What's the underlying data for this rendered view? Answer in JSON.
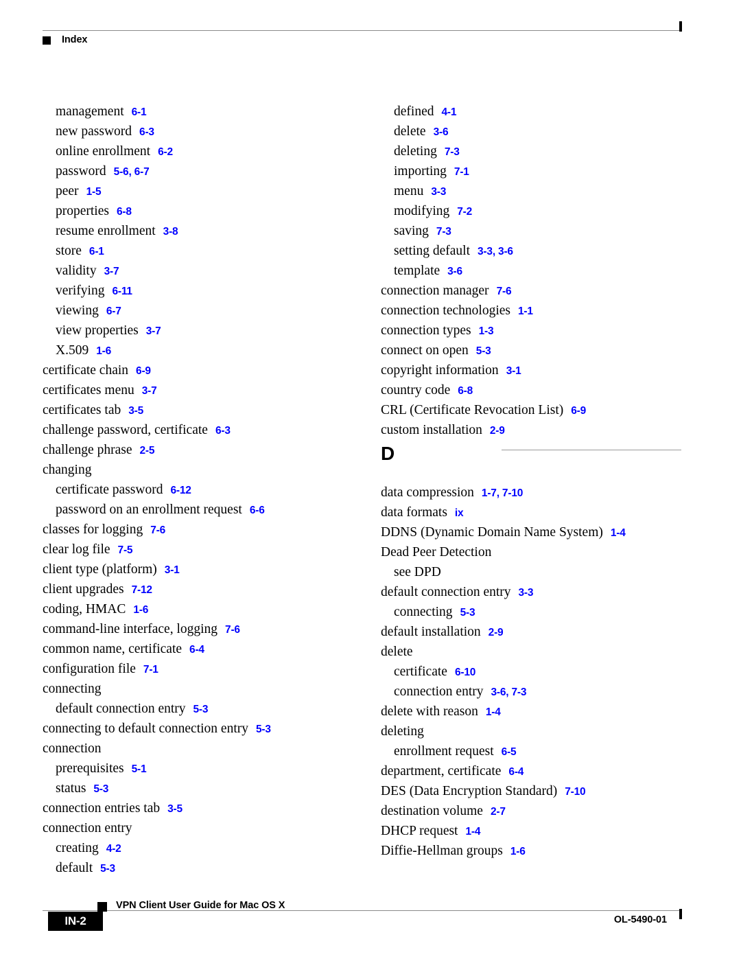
{
  "header": {
    "title": "Index",
    "bullet_icon": "black-square-icon"
  },
  "footer": {
    "page_number": "IN-2",
    "document_title": "VPN Client User Guide for Mac OS X",
    "document_id": "OL-5490-01",
    "bullet_icon": "black-square-icon"
  },
  "colors": {
    "reference_link": "#0000FF",
    "rule": "#8A8A8A",
    "text": "#000000"
  },
  "columns": {
    "left": [
      {
        "kind": "entry",
        "level": 1,
        "term": "management",
        "refs": "6-1"
      },
      {
        "kind": "entry",
        "level": 1,
        "term": "new password",
        "refs": "6-3"
      },
      {
        "kind": "entry",
        "level": 1,
        "term": "online enrollment",
        "refs": "6-2"
      },
      {
        "kind": "entry",
        "level": 1,
        "term": "password",
        "refs": "5-6, 6-7"
      },
      {
        "kind": "entry",
        "level": 1,
        "term": "peer",
        "refs": "1-5"
      },
      {
        "kind": "entry",
        "level": 1,
        "term": "properties",
        "refs": "6-8"
      },
      {
        "kind": "entry",
        "level": 1,
        "term": "resume enrollment",
        "refs": "3-8"
      },
      {
        "kind": "entry",
        "level": 1,
        "term": "store",
        "refs": "6-1"
      },
      {
        "kind": "entry",
        "level": 1,
        "term": "validity",
        "refs": "3-7"
      },
      {
        "kind": "entry",
        "level": 1,
        "term": "verifying",
        "refs": "6-11"
      },
      {
        "kind": "entry",
        "level": 1,
        "term": "viewing",
        "refs": "6-7"
      },
      {
        "kind": "entry",
        "level": 1,
        "term": "view properties",
        "refs": "3-7"
      },
      {
        "kind": "entry",
        "level": 1,
        "term": "X.509",
        "refs": "1-6"
      },
      {
        "kind": "entry",
        "level": 0,
        "term": "certificate chain",
        "refs": "6-9"
      },
      {
        "kind": "entry",
        "level": 0,
        "term": "certificates menu",
        "refs": "3-7"
      },
      {
        "kind": "entry",
        "level": 0,
        "term": "certificates tab",
        "refs": "3-5"
      },
      {
        "kind": "entry",
        "level": 0,
        "term": "challenge password, certificate",
        "refs": "6-3"
      },
      {
        "kind": "entry",
        "level": 0,
        "term": "challenge phrase",
        "refs": "2-5"
      },
      {
        "kind": "entry",
        "level": 0,
        "term": "changing",
        "refs": ""
      },
      {
        "kind": "entry",
        "level": 1,
        "term": "certificate password",
        "refs": "6-12"
      },
      {
        "kind": "entry",
        "level": 1,
        "term": "password on an enrollment request",
        "refs": "6-6"
      },
      {
        "kind": "entry",
        "level": 0,
        "term": "classes for logging",
        "refs": "7-6"
      },
      {
        "kind": "entry",
        "level": 0,
        "term": "clear log file",
        "refs": "7-5"
      },
      {
        "kind": "entry",
        "level": 0,
        "term": "client type (platform)",
        "refs": "3-1"
      },
      {
        "kind": "entry",
        "level": 0,
        "term": "client upgrades",
        "refs": "7-12"
      },
      {
        "kind": "entry",
        "level": 0,
        "term": "coding, HMAC",
        "refs": "1-6"
      },
      {
        "kind": "entry",
        "level": 0,
        "term": "command-line interface, logging",
        "refs": "7-6"
      },
      {
        "kind": "entry",
        "level": 0,
        "term": "common name, certificate",
        "refs": "6-4"
      },
      {
        "kind": "entry",
        "level": 0,
        "term": "configuration file",
        "refs": "7-1"
      },
      {
        "kind": "entry",
        "level": 0,
        "term": "connecting",
        "refs": ""
      },
      {
        "kind": "entry",
        "level": 1,
        "term": "default connection entry",
        "refs": "5-3"
      },
      {
        "kind": "entry",
        "level": 0,
        "term": "connecting to default connection entry",
        "refs": "5-3"
      },
      {
        "kind": "entry",
        "level": 0,
        "term": "connection",
        "refs": ""
      },
      {
        "kind": "entry",
        "level": 1,
        "term": "prerequisites",
        "refs": "5-1"
      },
      {
        "kind": "entry",
        "level": 1,
        "term": "status",
        "refs": "5-3"
      },
      {
        "kind": "entry",
        "level": 0,
        "term": "connection entries tab",
        "refs": "3-5"
      },
      {
        "kind": "entry",
        "level": 0,
        "term": "connection entry",
        "refs": ""
      },
      {
        "kind": "entry",
        "level": 1,
        "term": "creating",
        "refs": "4-2"
      },
      {
        "kind": "entry",
        "level": 1,
        "term": "default",
        "refs": "5-3"
      }
    ],
    "right": [
      {
        "kind": "entry",
        "level": 1,
        "term": "defined",
        "refs": "4-1"
      },
      {
        "kind": "entry",
        "level": 1,
        "term": "delete",
        "refs": "3-6"
      },
      {
        "kind": "entry",
        "level": 1,
        "term": "deleting",
        "refs": "7-3"
      },
      {
        "kind": "entry",
        "level": 1,
        "term": "importing",
        "refs": "7-1"
      },
      {
        "kind": "entry",
        "level": 1,
        "term": "menu",
        "refs": "3-3"
      },
      {
        "kind": "entry",
        "level": 1,
        "term": "modifying",
        "refs": "7-2"
      },
      {
        "kind": "entry",
        "level": 1,
        "term": "saving",
        "refs": "7-3"
      },
      {
        "kind": "entry",
        "level": 1,
        "term": "setting default",
        "refs": "3-3, 3-6"
      },
      {
        "kind": "entry",
        "level": 1,
        "term": "template",
        "refs": "3-6"
      },
      {
        "kind": "entry",
        "level": 0,
        "term": "connection manager",
        "refs": "7-6"
      },
      {
        "kind": "entry",
        "level": 0,
        "term": "connection technologies",
        "refs": "1-1"
      },
      {
        "kind": "entry",
        "level": 0,
        "term": "connection types",
        "refs": "1-3"
      },
      {
        "kind": "entry",
        "level": 0,
        "term": "connect on open",
        "refs": "5-3"
      },
      {
        "kind": "entry",
        "level": 0,
        "term": "copyright information",
        "refs": "3-1"
      },
      {
        "kind": "entry",
        "level": 0,
        "term": "country code",
        "refs": "6-8"
      },
      {
        "kind": "entry",
        "level": 0,
        "term": "CRL (Certificate Revocation List)",
        "refs": "6-9"
      },
      {
        "kind": "entry",
        "level": 0,
        "term": "custom installation",
        "refs": "2-9"
      },
      {
        "kind": "alpha",
        "letter": "D"
      },
      {
        "kind": "entry",
        "level": 0,
        "term": "data compression",
        "refs": "1-7, 7-10"
      },
      {
        "kind": "entry",
        "level": 0,
        "term": "data formats",
        "refs": "ix"
      },
      {
        "kind": "entry",
        "level": 0,
        "term": "DDNS (Dynamic Domain Name System)",
        "refs": "1-4"
      },
      {
        "kind": "entry",
        "level": 0,
        "term": "Dead Peer Detection",
        "refs": ""
      },
      {
        "kind": "entry",
        "level": 1,
        "term": "see DPD",
        "refs": ""
      },
      {
        "kind": "entry",
        "level": 0,
        "term": "default connection entry",
        "refs": "3-3"
      },
      {
        "kind": "entry",
        "level": 1,
        "term": "connecting",
        "refs": "5-3"
      },
      {
        "kind": "entry",
        "level": 0,
        "term": "default installation",
        "refs": "2-9"
      },
      {
        "kind": "entry",
        "level": 0,
        "term": "delete",
        "refs": ""
      },
      {
        "kind": "entry",
        "level": 1,
        "term": "certificate",
        "refs": "6-10"
      },
      {
        "kind": "entry",
        "level": 1,
        "term": "connection entry",
        "refs": "3-6, 7-3"
      },
      {
        "kind": "entry",
        "level": 0,
        "term": "delete with reason",
        "refs": "1-4"
      },
      {
        "kind": "entry",
        "level": 0,
        "term": "deleting",
        "refs": ""
      },
      {
        "kind": "entry",
        "level": 1,
        "term": "enrollment request",
        "refs": "6-5"
      },
      {
        "kind": "entry",
        "level": 0,
        "term": "department, certificate",
        "refs": "6-4"
      },
      {
        "kind": "entry",
        "level": 0,
        "term": "DES (Data Encryption Standard)",
        "refs": "7-10"
      },
      {
        "kind": "entry",
        "level": 0,
        "term": "destination volume",
        "refs": "2-7"
      },
      {
        "kind": "entry",
        "level": 0,
        "term": "DHCP request",
        "refs": "1-4"
      },
      {
        "kind": "entry",
        "level": 0,
        "term": "Diffie-Hellman groups",
        "refs": "1-6"
      }
    ]
  }
}
